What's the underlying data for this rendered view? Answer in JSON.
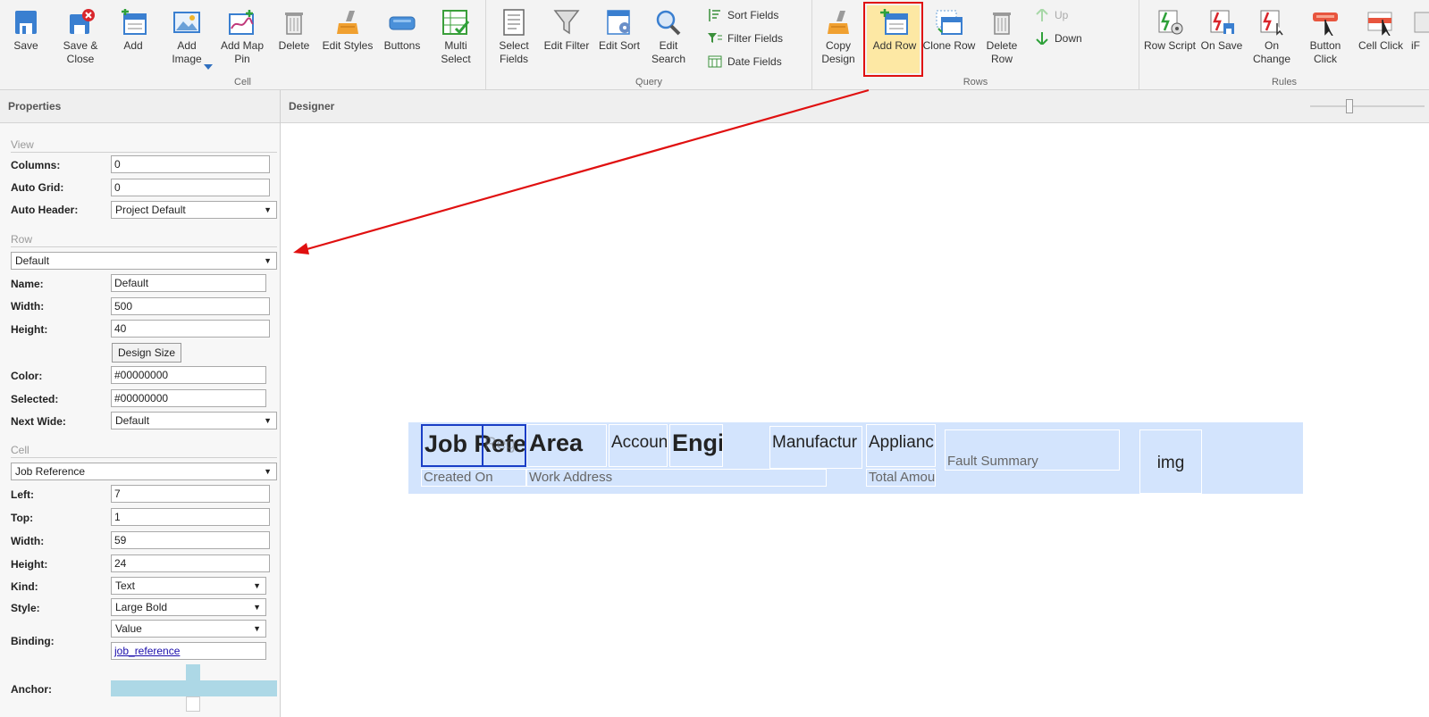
{
  "ribbon": {
    "groups": {
      "cell": "Cell",
      "query": "Query",
      "rows": "Rows",
      "rules": "Rules"
    },
    "cell_buttons": {
      "save": "Save",
      "save_close_1": "Save &",
      "save_close_2": "Close",
      "add": "Add",
      "add_image_1": "Add",
      "add_image_2": "Image",
      "add_map_1": "Add Map",
      "add_map_2": "Pin",
      "delete": "Delete",
      "edit_styles": "Edit Styles",
      "buttons": "Buttons",
      "multi_select_1": "Multi",
      "multi_select_2": "Select"
    },
    "query_buttons": {
      "select_fields_1": "Select",
      "select_fields_2": "Fields",
      "edit_filter": "Edit Filter",
      "edit_sort": "Edit Sort",
      "edit_search_1": "Edit",
      "edit_search_2": "Search",
      "sort_fields": "Sort Fields",
      "filter_fields": "Filter Fields",
      "date_fields": "Date Fields"
    },
    "rows_buttons": {
      "copy_design_1": "Copy",
      "copy_design_2": "Design",
      "add_row": "Add Row",
      "clone_row": "Clone Row",
      "delete_row_1": "Delete",
      "delete_row_2": "Row",
      "up": "Up",
      "down": "Down"
    },
    "rules_buttons": {
      "row_script": "Row Script",
      "on_save": "On Save",
      "on_change_1": "On",
      "on_change_2": "Change",
      "button_click_1": "Button",
      "button_click_2": "Click",
      "cell_click": "Cell Click",
      "if_truncated": "iF"
    }
  },
  "properties": {
    "title": "Properties",
    "view": {
      "section": "View",
      "columns_label": "Columns:",
      "columns_value": "0",
      "auto_grid_label": "Auto Grid:",
      "auto_grid_value": "0",
      "auto_header_label": "Auto Header:",
      "auto_header_value": "Project Default"
    },
    "row": {
      "section": "Row",
      "selector": "Default",
      "name_label": "Name:",
      "name_value": "Default",
      "width_label": "Width:",
      "width_value": "500",
      "height_label": "Height:",
      "height_value": "40",
      "design_size_button": "Design Size",
      "color_label": "Color:",
      "color_value": "#00000000",
      "selected_label": "Selected:",
      "selected_value": "#00000000",
      "next_wide_label": "Next Wide:",
      "next_wide_value": "Default"
    },
    "cell": {
      "section": "Cell",
      "selector": "Job Reference",
      "left_label": "Left:",
      "left_value": "7",
      "top_label": "Top:",
      "top_value": "1",
      "width_label": "Width:",
      "width_value": "59",
      "height_label": "Height:",
      "height_value": "24",
      "kind_label": "Kind:",
      "kind_value": "Text",
      "style_label": "Style:",
      "style_value": "Large Bold",
      "binding_label": "Binding:",
      "binding_mode": "Value",
      "binding_value": "job_reference",
      "anchor_label": "Anchor:"
    }
  },
  "designer": {
    "title": "Designer",
    "cells": {
      "job_ref": "Job Refe",
      "reg": "Reg",
      "area": "Area",
      "account": "Accoun",
      "engi": "Engi",
      "manufacturer": "Manufactur",
      "appliance": "Applianc",
      "fault_summary": "Fault Summary",
      "img": "img",
      "created_on": "Created On",
      "work_address": "Work Address",
      "total_amount": "Total Amou"
    }
  },
  "colors": {
    "highlight_red": "#e01010",
    "row_bg": "#d3e4fd",
    "selected_cell_border": "#1a3ec6",
    "add_row_bg": "#fde8a4"
  }
}
